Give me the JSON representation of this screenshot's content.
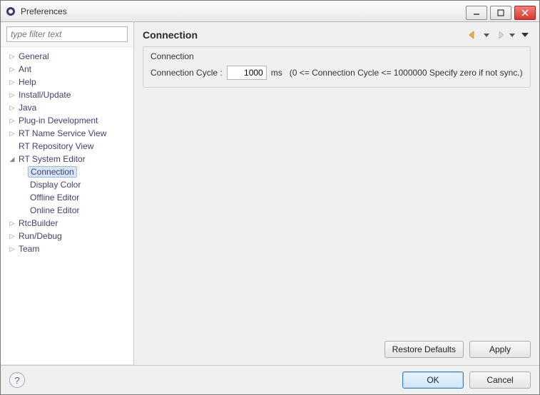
{
  "window": {
    "title": "Preferences"
  },
  "filter": {
    "placeholder": "type filter text"
  },
  "tree": {
    "items": [
      {
        "label": "General",
        "expandable": true
      },
      {
        "label": "Ant",
        "expandable": true
      },
      {
        "label": "Help",
        "expandable": true
      },
      {
        "label": "Install/Update",
        "expandable": true
      },
      {
        "label": "Java",
        "expandable": true
      },
      {
        "label": "Plug-in Development",
        "expandable": true
      },
      {
        "label": "RT Name Service View",
        "expandable": true
      },
      {
        "label": "RT Repository View",
        "expandable": false
      },
      {
        "label": "RT System Editor",
        "expandable": true,
        "expanded": true,
        "children": [
          {
            "label": "Connection",
            "selected": true
          },
          {
            "label": "Display Color"
          },
          {
            "label": "Offline Editor"
          },
          {
            "label": "Online Editor"
          }
        ]
      },
      {
        "label": "RtcBuilder",
        "expandable": true
      },
      {
        "label": "Run/Debug",
        "expandable": true
      },
      {
        "label": "Team",
        "expandable": true
      }
    ]
  },
  "page": {
    "title": "Connection",
    "group_title": "Connection",
    "field_label": "Connection Cycle :",
    "field_value": "1000",
    "unit": "ms",
    "hint": "(0 <= Connection Cycle <= 1000000 Specify zero if not sync.)"
  },
  "buttons": {
    "restore": "Restore Defaults",
    "apply": "Apply",
    "ok": "OK",
    "cancel": "Cancel"
  }
}
